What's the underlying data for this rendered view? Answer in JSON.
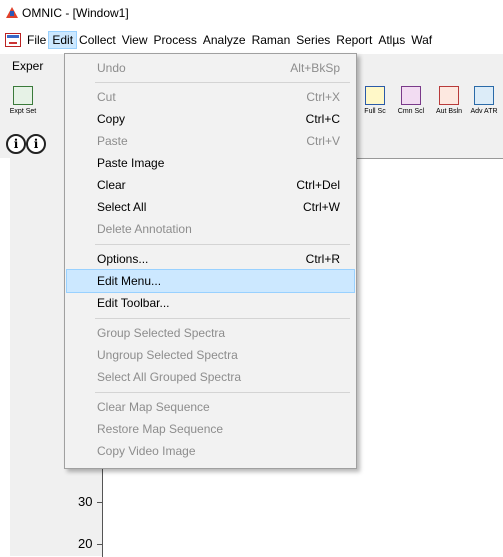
{
  "window": {
    "title": "OMNIC - [Window1]"
  },
  "menubar": {
    "items": [
      {
        "label": "File"
      },
      {
        "label": "Edit"
      },
      {
        "label": "Collect"
      },
      {
        "label": "View"
      },
      {
        "label": "Process"
      },
      {
        "label": "Analyze"
      },
      {
        "label": "Raman"
      },
      {
        "label": "Series"
      },
      {
        "label": "Report"
      },
      {
        "label": "Atlµs"
      },
      {
        "label": "Waf"
      }
    ]
  },
  "experiment": {
    "label": "Exper"
  },
  "toolbar": {
    "buttons": [
      {
        "label": "Expt Set",
        "icon": "experiment-setup-icon"
      },
      {
        "label": "Full Sc",
        "icon": "full-scale-icon"
      },
      {
        "label": "Cmn Scl",
        "icon": "common-scale-icon"
      },
      {
        "label": "Aut Bsln",
        "icon": "auto-baseline-icon"
      },
      {
        "label": "Adv ATR",
        "icon": "advanced-atr-icon"
      }
    ]
  },
  "info_buttons": [
    {
      "label": "i"
    },
    {
      "label": "i"
    }
  ],
  "edit_menu": {
    "items": [
      {
        "label": "Undo",
        "shortcut": "Alt+BkSp",
        "enabled": false
      },
      {
        "label": "Cut",
        "shortcut": "Ctrl+X",
        "enabled": false
      },
      {
        "label": "Copy",
        "shortcut": "Ctrl+C",
        "enabled": true
      },
      {
        "label": "Paste",
        "shortcut": "Ctrl+V",
        "enabled": false
      },
      {
        "label": "Paste Image",
        "shortcut": "",
        "enabled": true
      },
      {
        "label": "Clear",
        "shortcut": "Ctrl+Del",
        "enabled": true
      },
      {
        "label": "Select All",
        "shortcut": "Ctrl+W",
        "enabled": true
      },
      {
        "label": "Delete Annotation",
        "shortcut": "",
        "enabled": false
      },
      {
        "label": "Options...",
        "shortcut": "Ctrl+R",
        "enabled": true
      },
      {
        "label": "Edit Menu...",
        "shortcut": "",
        "enabled": true,
        "highlighted": true
      },
      {
        "label": "Edit Toolbar...",
        "shortcut": "",
        "enabled": true
      },
      {
        "label": "Group Selected Spectra",
        "shortcut": "",
        "enabled": false
      },
      {
        "label": "Ungroup Selected Spectra",
        "shortcut": "",
        "enabled": false
      },
      {
        "label": "Select All Grouped Spectra",
        "shortcut": "",
        "enabled": false
      },
      {
        "label": "Clear Map Sequence",
        "shortcut": "",
        "enabled": false
      },
      {
        "label": "Restore Map Sequence",
        "shortcut": "",
        "enabled": false
      },
      {
        "label": "Copy Video Image",
        "shortcut": "",
        "enabled": false
      }
    ]
  },
  "spectrum": {
    "y_ticks": [
      "30",
      "20"
    ]
  },
  "colors": {
    "highlight": "#cce8ff",
    "menu_bg": "#f2f2f2",
    "disabled_text": "#8d8d8d"
  }
}
